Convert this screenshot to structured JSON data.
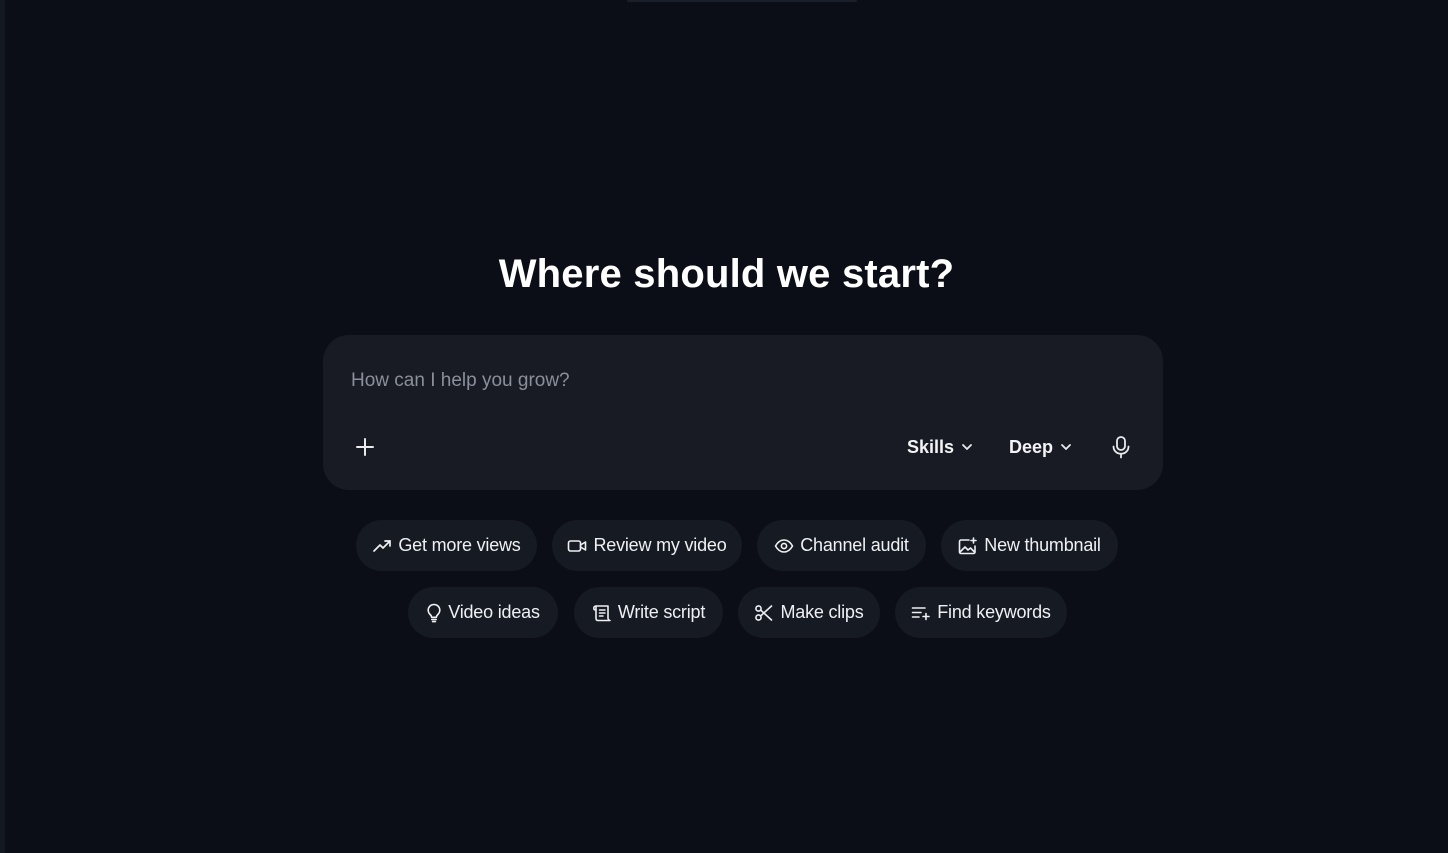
{
  "headline": "Where should we start?",
  "composer": {
    "placeholder": "How can I help you grow?",
    "skills_label": "Skills",
    "depth_label": "Deep"
  },
  "suggestions": {
    "row1": [
      {
        "label": "Get more views",
        "icon": "trending-up-icon"
      },
      {
        "label": "Review my video",
        "icon": "video-camera-icon"
      },
      {
        "label": "Channel audit",
        "icon": "eye-icon"
      },
      {
        "label": "New thumbnail",
        "icon": "image-sparkle-icon"
      }
    ],
    "row2": [
      {
        "label": "Video ideas",
        "icon": "lightbulb-icon"
      },
      {
        "label": "Write script",
        "icon": "scroll-icon"
      },
      {
        "label": "Make clips",
        "icon": "scissors-icon"
      },
      {
        "label": "Find keywords",
        "icon": "list-plus-icon"
      }
    ]
  },
  "colors": {
    "background": "#0b0e16",
    "surface": "#181b24",
    "chip": "#161a23",
    "text": "#f2f3f5",
    "placeholder": "#8a8f99"
  }
}
